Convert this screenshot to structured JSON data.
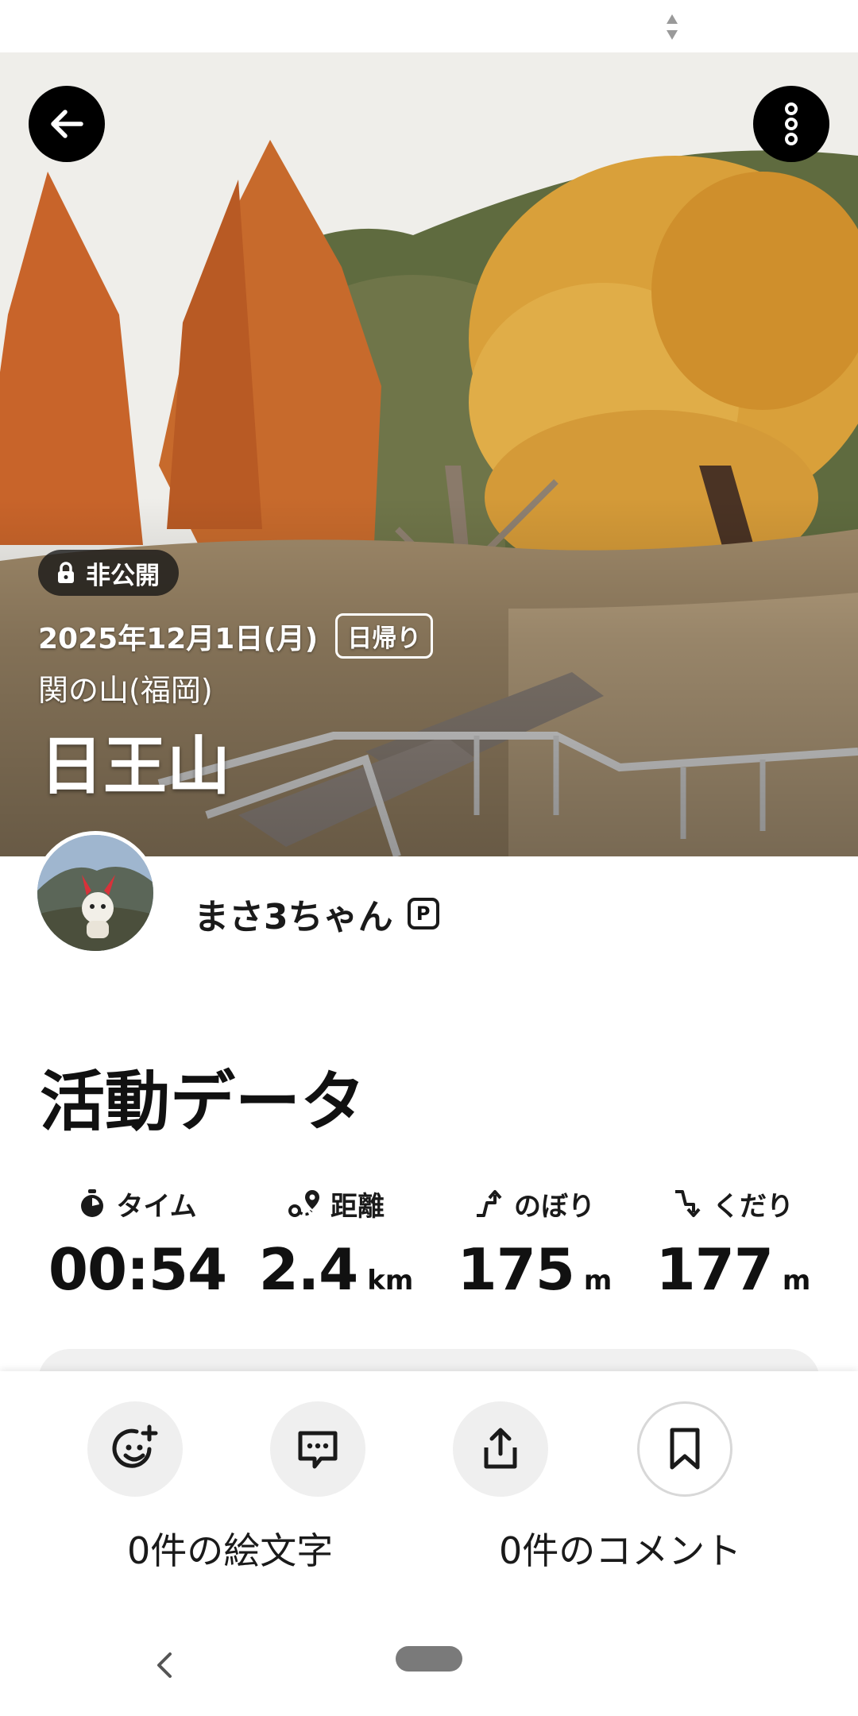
{
  "hero": {
    "visibility_badge": "非公開",
    "date": "2025年12月1日(月)",
    "trip_type": "日帰り",
    "area": "関の山(福岡)",
    "mountain_name": "日王山"
  },
  "user": {
    "name": "まさ3ちゃん",
    "premium_mark": "P"
  },
  "activity": {
    "section_title": "活動データ",
    "stats": [
      {
        "label": "タイム",
        "value": "00:54",
        "unit": ""
      },
      {
        "label": "距離",
        "value": "2.4",
        "unit": "km"
      },
      {
        "label": "のぼり",
        "value": "175",
        "unit": "m"
      },
      {
        "label": "くだり",
        "value": "177",
        "unit": "m"
      }
    ]
  },
  "actions": {
    "emoji_count_text": "0件の絵文字",
    "comment_count_text": "0件のコメント"
  },
  "colors": {
    "button_bg": "#000000",
    "action_bg": "#efefef",
    "text": "#111111"
  }
}
